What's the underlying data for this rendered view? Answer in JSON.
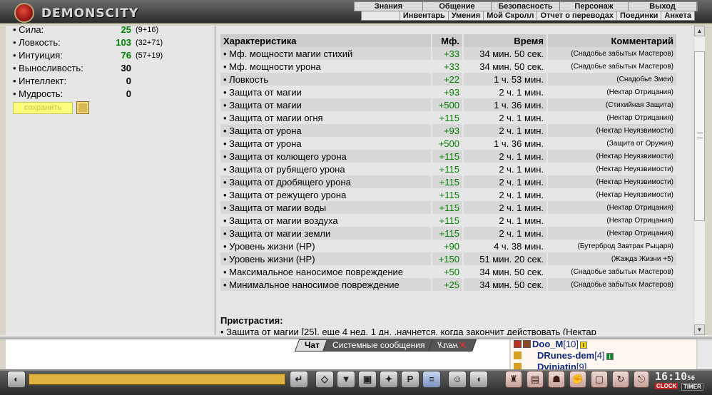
{
  "logo": {
    "text": "DEMONSCITY"
  },
  "menu": {
    "top": [
      "Знания",
      "Общение",
      "Безопасность",
      "Персонаж",
      "Выход"
    ],
    "sub": [
      "Инвентарь",
      "Умения",
      "Мой Скролл",
      "Отчет о переводах",
      "Поединки",
      "Анкета"
    ]
  },
  "stats": [
    {
      "name": "• Сила:",
      "value": "25",
      "bonus": "(9+16)",
      "color": "#008000"
    },
    {
      "name": "• Ловкость:",
      "value": "103",
      "bonus": "(32+71)",
      "color": "#008000"
    },
    {
      "name": "• Интуиция:",
      "value": "76",
      "bonus": "(57+19)",
      "color": "#008000"
    },
    {
      "name": "• Выносливость:",
      "value": "30",
      "bonus": "",
      "color": "#000000"
    },
    {
      "name": "• Интеллект:",
      "value": "0",
      "bonus": "",
      "color": "#000000"
    },
    {
      "name": "• Мудрость:",
      "value": "0",
      "bonus": "",
      "color": "#000000"
    }
  ],
  "save_button": "сохранить",
  "table": {
    "headers": [
      "Характеристика",
      "Мф.",
      "Время",
      "Комментарий"
    ],
    "rows": [
      [
        "• Мф. мощности магии стихий",
        "+33",
        "34 мин. 50 сек.",
        "(Снадобье забытых Мастеров)"
      ],
      [
        "• Мф. мощности урона",
        "+33",
        "34 мин. 50 сек.",
        "(Снадобье забытых Мастеров)"
      ],
      [
        "• Ловкость",
        "+22",
        "1 ч. 53 мин.",
        "(Снадобье Змеи)"
      ],
      [
        "• Защита от магии",
        "+93",
        "2 ч. 1 мин.",
        "(Нектар Отрицания)"
      ],
      [
        "• Защита от магии",
        "+500",
        "1 ч. 36 мин.",
        "(Стихийная Защита)"
      ],
      [
        "• Защита от магии огня",
        "+115",
        "2 ч. 1 мин.",
        "(Нектар Отрицания)"
      ],
      [
        "• Защита от урона",
        "+93",
        "2 ч. 1 мин.",
        "(Нектар Неуязвимости)"
      ],
      [
        "• Защита от урона",
        "+500",
        "1 ч. 36 мин.",
        "(Защита от Оружия)"
      ],
      [
        "• Защита от колющего урона",
        "+115",
        "2 ч. 1 мин.",
        "(Нектар Неуязвимости)"
      ],
      [
        "• Защита от рубящего урона",
        "+115",
        "2 ч. 1 мин.",
        "(Нектар Неуязвимости)"
      ],
      [
        "• Защита от дробящего урона",
        "+115",
        "2 ч. 1 мин.",
        "(Нектар Неуязвимости)"
      ],
      [
        "• Защита от режущего урона",
        "+115",
        "2 ч. 1 мин.",
        "(Нектар Неуязвимости)"
      ],
      [
        "• Защита от магии воды",
        "+115",
        "2 ч. 1 мин.",
        "(Нектар Отрицания)"
      ],
      [
        "• Защита от магии воздуха",
        "+115",
        "2 ч. 1 мин.",
        "(Нектар Отрицания)"
      ],
      [
        "• Защита от магии земли",
        "+115",
        "2 ч. 1 мин.",
        "(Нектар Отрицания)"
      ],
      [
        "• Уровень жизни (HP)",
        "+90",
        "4 ч. 38 мин.",
        "(Бутерброд Завтрак Рыцаря)"
      ],
      [
        "• Уровень жизни (HP)",
        "+150",
        "51 мин. 20 сек.",
        "(Жажда Жизни +5)"
      ],
      [
        "• Максимальное наносимое повреждение",
        "+50",
        "34 мин. 50 сек.",
        "(Снадобье забытых Мастеров)"
      ],
      [
        "• Минимальное наносимое повреждение",
        "+25",
        "34 мин. 50 сек.",
        "(Снадобье забытых Мастеров)"
      ]
    ]
  },
  "addictions": {
    "title": "Пристрастия:",
    "line": "• Защита от магии [25], еще 4 нед. 1 дн. ,начнется, когда закончит действовать (Нектар"
  },
  "chat_tabs": [
    "Чат",
    "Системные сообщения",
    "Клан"
  ],
  "online": [
    {
      "nick": "Doo_M",
      "level": "[10]",
      "info_color": "#f0d800"
    },
    {
      "nick": "DRunes-dem",
      "level": "[4]",
      "info_color": "#0a8a2a"
    },
    {
      "nick": "Dviniatin",
      "level": "[9]",
      "info_color": "#2a8ad8"
    }
  ],
  "clock": {
    "time": "16:10",
    "seconds": "56",
    "clock_label": "CLOCK",
    "timer_label": "TIMER"
  },
  "colors": {
    "accent_green": "#008000",
    "nick_blue": "#102a8a",
    "input_gold": "#e0b240"
  },
  "icons": {
    "bottom_left": [
      "chat-mode-icon",
      "enter-icon",
      "eraser-icon",
      "filter-icon",
      "save-log-icon",
      "fight-icon",
      "private-icon",
      "translit-icon",
      "smiley-icon",
      "speaker-icon"
    ],
    "bottom_right": [
      "bag-icon",
      "lock-icon",
      "helmet-icon",
      "fist-icon",
      "padlock-icon",
      "rotate-icon",
      "flag-icon",
      "exit-icon"
    ]
  }
}
